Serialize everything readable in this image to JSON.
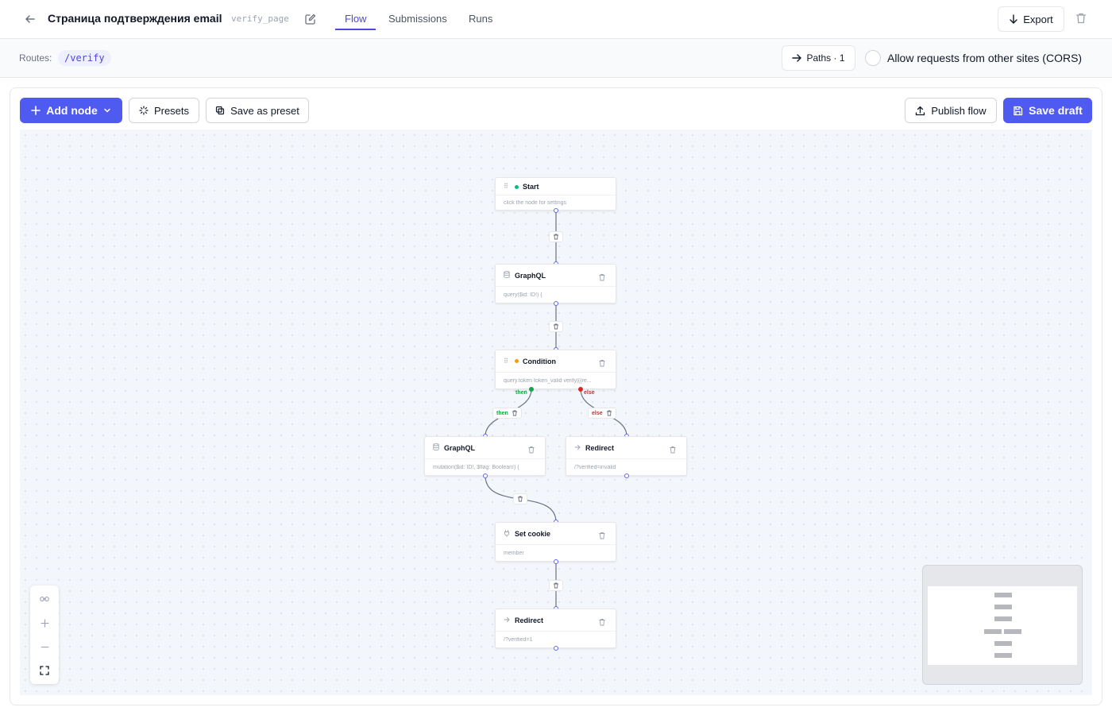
{
  "header": {
    "title": "Страница подтверждения email",
    "slug": "verify_page",
    "tabs": [
      {
        "label": "Flow",
        "active": true
      },
      {
        "label": "Submissions",
        "active": false
      },
      {
        "label": "Runs",
        "active": false
      }
    ],
    "export_label": "Export"
  },
  "routes": {
    "label": "Routes:",
    "items": [
      "/verify"
    ],
    "paths_label": "Paths · 1",
    "cors_label": "Allow requests from other sites (CORS)",
    "cors_checked": false
  },
  "toolbar": {
    "add_node_label": "Add node",
    "presets_label": "Presets",
    "save_preset_label": "Save as preset",
    "publish_label": "Publish flow",
    "save_draft_label": "Save draft"
  },
  "flow": {
    "nodes": [
      {
        "id": "start",
        "title": "Start",
        "subtitle": "click the node for settings",
        "icon": "drag-handle-icon",
        "status_color": "#10b981"
      },
      {
        "id": "graphql1",
        "title": "GraphQL",
        "subtitle": "query($id: ID!) {",
        "icon": "database-icon"
      },
      {
        "id": "condition",
        "title": "Condition",
        "subtitle": "query.token token_valid verify|{{re...",
        "icon": "drag-handle-icon",
        "status_color": "#f59e0b"
      },
      {
        "id": "graphql2",
        "title": "GraphQL",
        "subtitle": "mutation($id: ID!, $flag: Boolean!) {",
        "icon": "database-icon"
      },
      {
        "id": "redirect1",
        "title": "Redirect",
        "subtitle": "/?verified=invalid",
        "icon": "arrow-right-icon"
      },
      {
        "id": "setcookie",
        "title": "Set cookie",
        "subtitle": "member",
        "icon": "plug-icon"
      },
      {
        "id": "redirect2",
        "title": "Redirect",
        "subtitle": "/?verified=1",
        "icon": "arrow-right-icon"
      }
    ],
    "edge_labels": {
      "then": "then",
      "else": "else"
    },
    "colors": {
      "then": "#16a34a",
      "else": "#dc2626",
      "accent": "#4f46e5",
      "edge": "#6b7280"
    }
  }
}
